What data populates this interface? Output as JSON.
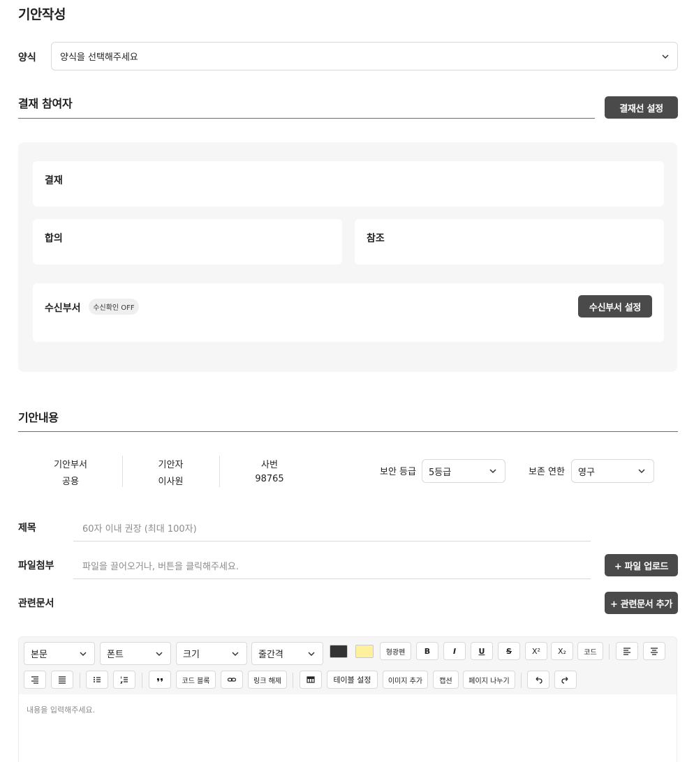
{
  "page": {
    "title": "기안작성"
  },
  "form_select": {
    "label": "양식",
    "value": "양식을 선택해주세요"
  },
  "approval": {
    "heading": "결재 참여자",
    "settings_button": "결재선 설정",
    "cards": {
      "approval": "결재",
      "agreement": "합의",
      "reference": "참조",
      "recipient": "수신부서"
    },
    "receipt_badge": "수신확인 OFF",
    "recipient_button": "수신부서 설정"
  },
  "content": {
    "heading": "기안내용",
    "info": [
      {
        "label": "기안부서",
        "value": "공용"
      },
      {
        "label": "기안자",
        "value": "이사원"
      },
      {
        "label": "사번",
        "value": "98765"
      }
    ],
    "security": {
      "label": "보안 등급",
      "value": "5등급"
    },
    "retention": {
      "label": "보존 연한",
      "value": "영구"
    },
    "subject": {
      "label": "제목",
      "placeholder": "60자 이내 권장 (최대 100자)"
    },
    "attachment": {
      "label": "파일첨부",
      "placeholder": "파일을 끌어오거나, 버튼을 클릭해주세요.",
      "button": "+ 파일 업로드"
    },
    "related": {
      "label": "관련문서",
      "button": "+ 관련문서 추가"
    }
  },
  "editor": {
    "selects": {
      "paragraph": "본문",
      "font": "폰트",
      "size": "크기",
      "line_height": "줄간격"
    },
    "colors": {
      "text": "#333333",
      "highlight": "#fff19c"
    },
    "buttons": {
      "highlighter": "형광펜",
      "bold": "B",
      "italic": "I",
      "underline": "U",
      "strike": "S",
      "superscript": "X²",
      "subscript": "X₂",
      "code": "코드",
      "code_block": "코드 블록",
      "unlink": "링크 해제",
      "table_settings": "테이블 설정",
      "add_image": "이미지 추가",
      "caption": "캡션",
      "page_break": "페이지 나누기"
    },
    "icons": {
      "align_left": "align-left-icon",
      "align_center": "align-center-icon",
      "align_right": "align-right-icon",
      "justify": "align-justify-icon",
      "bullet_list": "bullet-list-icon",
      "ordered_list": "ordered-list-icon",
      "quote": "quote-icon",
      "link": "link-icon",
      "table": "table-icon",
      "undo": "undo-icon",
      "redo": "redo-icon"
    },
    "placeholder": "내용을 입력해주세요."
  }
}
